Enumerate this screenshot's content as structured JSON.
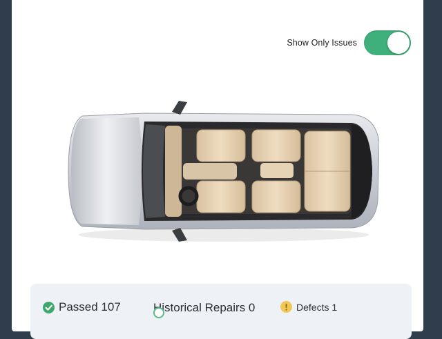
{
  "filter": {
    "label": "Show Only Issues",
    "enabled": true
  },
  "summary": {
    "passed": "Passed 107",
    "historical": "Historical Repairs 0",
    "defects": "Defects 1"
  },
  "icons": {
    "passed": "check-circle-icon",
    "historical": "history-icon",
    "defects": "warning-icon"
  },
  "colors": {
    "toggle_on": "#3fb07b",
    "passed": "#3ea86b",
    "defects": "#f0c654",
    "panel_bg": "#eef1f6"
  }
}
